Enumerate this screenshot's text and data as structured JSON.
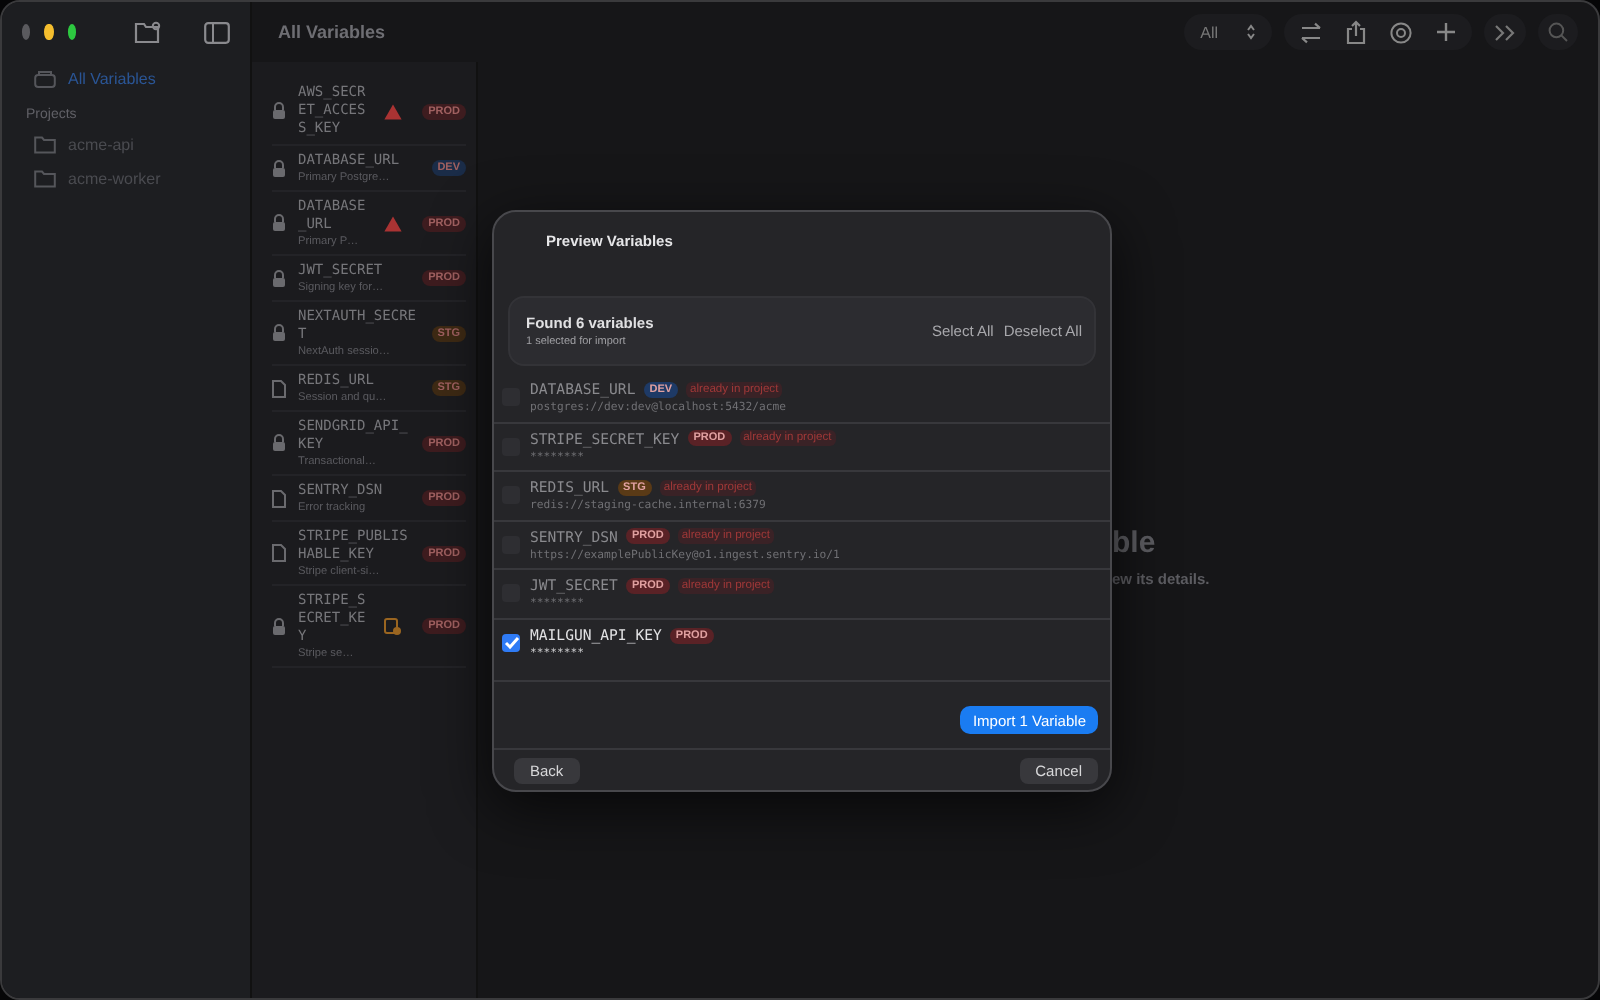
{
  "sidebar": {
    "items": [
      {
        "label": "All Variables",
        "selected": true
      }
    ],
    "section": "Projects",
    "projects": [
      {
        "label": "acme-api",
        "selected": false
      },
      {
        "label": "acme-worker",
        "selected": false
      }
    ]
  },
  "header": {
    "title": "All Variables",
    "filter": "All"
  },
  "variables": [
    {
      "name": "AWS_SECRET_ACCESS_KEY",
      "kind": "locked-warning",
      "env": "PROD",
      "color": "#3e1c1f"
    },
    {
      "name": "DATABASE_URL",
      "kind": "locked",
      "env": "DEV",
      "color": "#1a2c48",
      "description": "Primary Postgre…"
    },
    {
      "name": "DATABASE_URL",
      "kind": "locked-warning",
      "env": "PROD",
      "color": "#3e1c1f",
      "description": "Primary P…"
    },
    {
      "name": "JWT_SECRET",
      "kind": "locked",
      "env": "PROD",
      "color": "#3e1c1f",
      "description": "Signing key for…"
    },
    {
      "name": "NEXTAUTH_SECRET",
      "kind": "locked",
      "env": "STG",
      "color": "#3e2a14",
      "description": "NextAuth sessio…"
    },
    {
      "name": "REDIS_URL",
      "kind": "file",
      "env": "STG",
      "color": "#3e2a14",
      "description": "Session and qu…"
    },
    {
      "name": "SENDGRID_API_KEY",
      "kind": "locked",
      "env": "PROD",
      "color": "#3e1c1f",
      "description": "Transactional…"
    },
    {
      "name": "SENTRY_DSN",
      "kind": "file",
      "env": "PROD",
      "color": "#3e1c1f",
      "description": "Error tracking"
    },
    {
      "name": "STRIPE_PUBLISHABLE_KEY",
      "kind": "file",
      "env": "PROD",
      "color": "#3e1c1f",
      "description": "Stripe client-si…"
    },
    {
      "name": "STRIPE_SECRET_KEY",
      "kind": "locked-notice",
      "env": "PROD",
      "color": "#3e1c1f",
      "description": "Stripe se…"
    }
  ],
  "detail": {
    "title_fragment": "ble",
    "hint_fragment": "ew its details."
  },
  "dialog": {
    "title": "Preview Variables",
    "found": "Found 6 variables",
    "selected_count": "1 selected for import",
    "select_all": "Select All",
    "deselect_all": "Deselect All",
    "rows": [
      {
        "name": "DATABASE_URL",
        "env": "DEV",
        "color": "#1e3a66",
        "status": "already in project",
        "value": "postgres://dev:dev@localhost:5432/acme",
        "checked": false
      },
      {
        "name": "STRIPE_SECRET_KEY",
        "env": "PROD",
        "color": "#5a2226",
        "status": "already in project",
        "value": "********",
        "checked": false
      },
      {
        "name": "REDIS_URL",
        "env": "STG",
        "color": "#5a3a16",
        "status": "already in project",
        "value": "redis://staging-cache.internal:6379",
        "checked": false
      },
      {
        "name": "SENTRY_DSN",
        "env": "PROD",
        "color": "#5a2226",
        "status": "already in project",
        "value": "https://examplePublicKey@o1.ingest.sentry.io/1",
        "checked": false
      },
      {
        "name": "JWT_SECRET",
        "env": "PROD",
        "color": "#5a2226",
        "status": "already in project",
        "value": "********",
        "checked": false
      },
      {
        "name": "MAILGUN_API_KEY",
        "env": "PROD",
        "color": "#5a2226",
        "value": "********",
        "checked": true
      }
    ],
    "import_button": "Import 1 Variable",
    "back": "Back",
    "cancel": "Cancel"
  }
}
